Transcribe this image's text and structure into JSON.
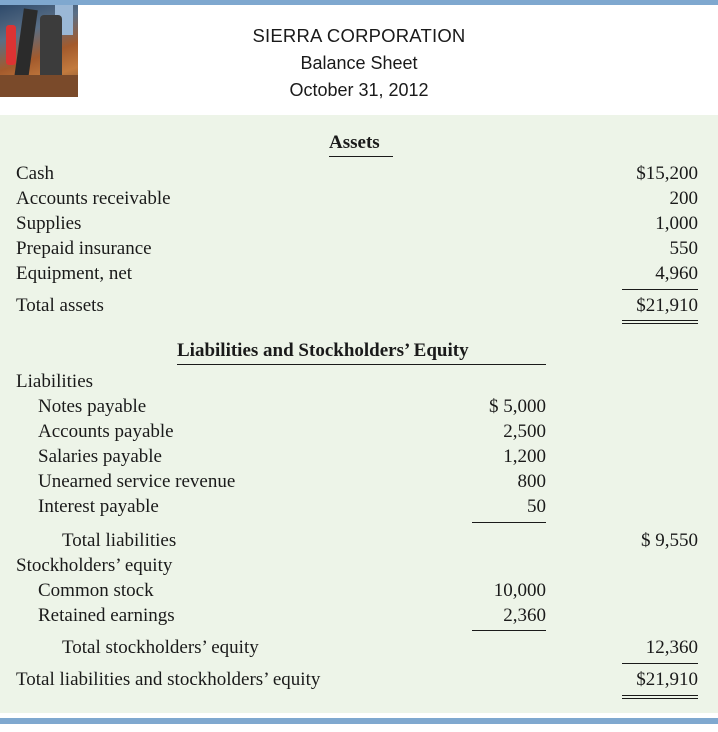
{
  "header": {
    "company": "SIERRA CORPORATION",
    "statement": "Balance Sheet",
    "date": "October 31, 2012"
  },
  "assets": {
    "heading": "Assets",
    "items": [
      {
        "label": "Cash",
        "amount": "$15,200"
      },
      {
        "label": "Accounts receivable",
        "amount": "200"
      },
      {
        "label": "Supplies",
        "amount": "1,000"
      },
      {
        "label": "Prepaid insurance",
        "amount": "550"
      },
      {
        "label": "Equipment, net",
        "amount": "4,960"
      }
    ],
    "total_label": "Total assets",
    "total": "$21,910"
  },
  "liab_equity": {
    "heading": "Liabilities and Stockholders’ Equity",
    "liabilities_label": "Liabilities",
    "liabilities": [
      {
        "label": "Notes payable",
        "amount": "$ 5,000"
      },
      {
        "label": "Accounts payable",
        "amount": "2,500"
      },
      {
        "label": "Salaries payable",
        "amount": "1,200"
      },
      {
        "label": "Unearned service revenue",
        "amount": "800"
      },
      {
        "label": "Interest payable",
        "amount": "50"
      }
    ],
    "total_liabilities_label": "Total liabilities",
    "total_liabilities": "$ 9,550",
    "equity_label": "Stockholders’ equity",
    "equity": [
      {
        "label": "Common stock",
        "amount": "10,000"
      },
      {
        "label": "Retained earnings",
        "amount": "2,360"
      }
    ],
    "total_equity_label": "Total stockholders’ equity",
    "total_equity": "12,360",
    "grand_total_label": "Total liabilities and stockholders’ equity",
    "grand_total": "$21,910"
  }
}
